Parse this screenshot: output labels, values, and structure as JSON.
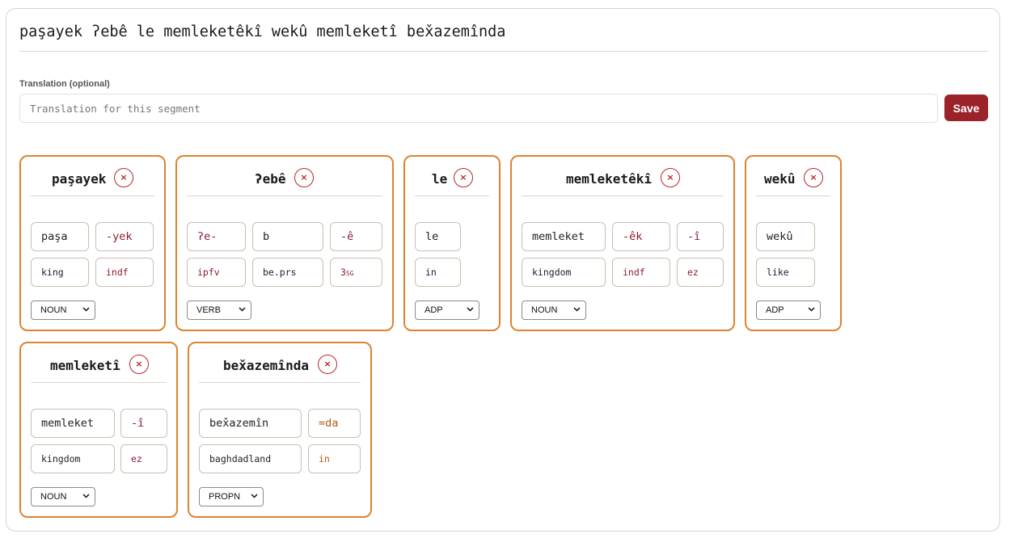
{
  "segment": {
    "text": "paşayek ʔebê le memleketêkî wekû memleketî bex̌azemînda"
  },
  "translation": {
    "label": "Translation (optional)",
    "placeholder": "Translation for this segment",
    "save_label": "Save"
  },
  "tokens": [
    {
      "word": "paşayek",
      "delete_glyph": "×",
      "morphs": [
        {
          "form": "paşa",
          "gloss": "king",
          "kind": "stem"
        },
        {
          "form": "-yek",
          "gloss": "indf",
          "kind": "suffix"
        }
      ],
      "pos": "NOUN"
    },
    {
      "word": "ʔebê",
      "delete_glyph": "×",
      "morphs": [
        {
          "form": "ʔe-",
          "gloss": "ipfv",
          "kind": "suffix"
        },
        {
          "form": "b",
          "gloss": "be.prs",
          "kind": "stem"
        },
        {
          "form": "-ê",
          "gloss": "3sg",
          "kind": "suffix"
        }
      ],
      "pos": "VERB"
    },
    {
      "word": "le",
      "delete_glyph": "×",
      "morphs": [
        {
          "form": "le",
          "gloss": "in",
          "kind": "stem"
        }
      ],
      "pos": "ADP"
    },
    {
      "word": "memleketêkî",
      "delete_glyph": "×",
      "morphs": [
        {
          "form": "memleket",
          "gloss": "kingdom",
          "kind": "stem"
        },
        {
          "form": "-êk",
          "gloss": "indf",
          "kind": "suffix"
        },
        {
          "form": "-î",
          "gloss": "ez",
          "kind": "suffix"
        }
      ],
      "pos": "NOUN"
    },
    {
      "word": "wekû",
      "delete_glyph": "×",
      "morphs": [
        {
          "form": "wekû",
          "gloss": "like",
          "kind": "stem"
        }
      ],
      "pos": "ADP"
    },
    {
      "word": "memleketî",
      "delete_glyph": "×",
      "morphs": [
        {
          "form": "memleket",
          "gloss": "kingdom",
          "kind": "stem"
        },
        {
          "form": "-î",
          "gloss": "ez",
          "kind": "suffix"
        }
      ],
      "pos": "NOUN"
    },
    {
      "word": "bex̌azemînda",
      "delete_glyph": "×",
      "morphs": [
        {
          "form": "bex̌azemîn",
          "gloss": "baghdadland",
          "kind": "stem"
        },
        {
          "form": "=da",
          "gloss": "in",
          "kind": "clitic"
        }
      ],
      "pos": "PROPN"
    }
  ],
  "colors": {
    "card_border": "#dd8330",
    "suffix_text": "#8b1d35",
    "clitic_text": "#b45a10",
    "save_button": "#9b2228",
    "delete_button": "#b8262e"
  }
}
